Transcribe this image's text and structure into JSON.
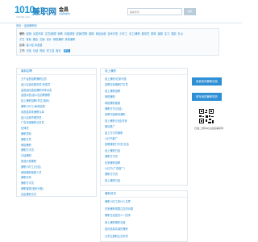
{
  "header": {
    "logo_num": "1010",
    "logo_text": "兼职网",
    "logo_sub": "1010jz.com",
    "city": "金昌",
    "city_switch": "[切换城市]",
    "search_placeholder": "兼职搜索",
    "search_button": "搜索"
  },
  "breadcrumb": {
    "home": "首页",
    "current": "金昌兼职网"
  },
  "filter": {
    "cat_label": "兼职:",
    "categories": [
      "促销",
      "派发传单",
      "文员/助理",
      "家教",
      "问卷调查",
      "促销/导购",
      "翻译",
      "网站运营",
      "技术开发",
      "小时工",
      "手工/兼职",
      "服务员",
      "模特",
      "客服",
      "实习",
      "摄影",
      "礼仪",
      "才艺",
      "其他",
      "展会",
      "文案",
      "设计",
      "网络兼职",
      "其他兼职"
    ],
    "area_label": "区域:",
    "areas": [
      "金川区",
      "永昌县"
    ],
    "type_label": "工作:",
    "types": [
      "日结",
      "月结",
      "周结",
      "完工结",
      "面议"
    ],
    "type_button": "提交"
  },
  "left_panel": {
    "title": "最新招聘",
    "items": [
      "五千金昌招聘兼职店员",
      "金川区酒店服务员/传菜员",
      "金昌酒店直招兼职传单派发",
      "金昌永昌/金川区招聘兼职",
      "线上兼职招聘(学生/宝妈)",
      "兼职小时工/每周结算",
      "永昌县周末兼职派单",
      "金川区超市理货员",
      "广告传媒兼职业务员",
      "纪律员",
      "兼职导购",
      "兼职文员",
      "网络兼职",
      "兼职打字员",
      "日结兼职",
      "快递分拣兼职",
      "兼职小时工(日结)",
      "网络兼职客服人员",
      "兼职传单",
      "兼职打字员",
      "兼职客服(宝妈可做)",
      "自由兼职文员"
    ]
  },
  "mid_panel": {
    "title": "线上兼职",
    "items": [
      "线上兼职/在家可做",
      "招聘在家兼职打字员",
      "线上兼职招聘",
      "网络兼职",
      "网络兼职客服",
      "兼职打字(日结)",
      "招聘淘宝刷单兼职",
      "线上兼职/日结/在家",
      "微信推广",
      "线上打字员兼职",
      "小红书推广",
      "招聘兼职打字员/日结",
      "线上兼职日结",
      "兼职打字员",
      "在家兼职招聘",
      "小红书(广告推广)",
      "兼职打字员",
      "线上兼职日结"
    ]
  },
  "low_panel": {
    "title": "兼职资讯",
    "items": [
      "兼职小时工是什么意思",
      "在家兼职需要注意的问题",
      "兼职日结是怎么一回事",
      "网上兼职哪些靠谱",
      "如何选择靠谱的兼职",
      "大学生兼职注意事项"
    ]
  },
  "sidebar": {
    "btn_publish": "免费发布兼职信息",
    "btn_resume": "填写我的兼职简历",
    "qr_caption": "扫描二维码关注金昌兼职网"
  }
}
